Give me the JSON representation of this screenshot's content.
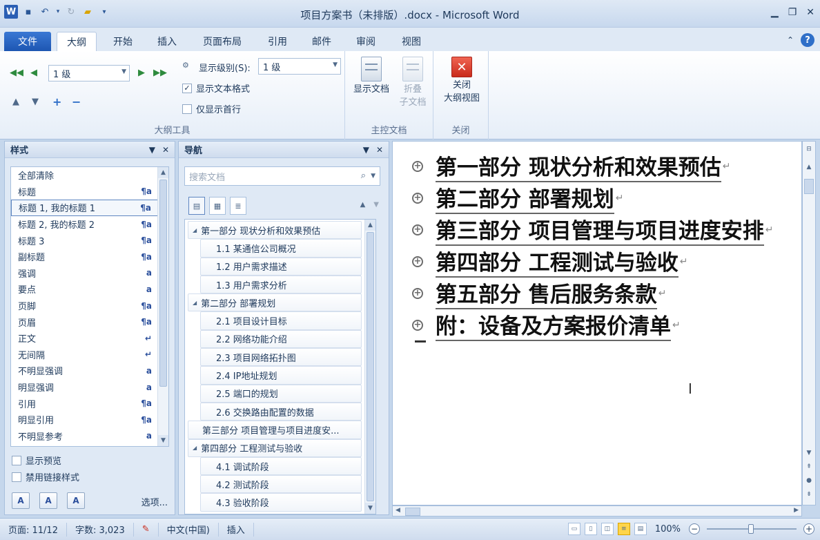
{
  "window": {
    "title": "项目方案书（未排版）.docx - Microsoft Word"
  },
  "tabs": [
    {
      "label": "文件"
    },
    {
      "label": "大纲"
    },
    {
      "label": "开始"
    },
    {
      "label": "插入"
    },
    {
      "label": "页面布局"
    },
    {
      "label": "引用"
    },
    {
      "label": "邮件"
    },
    {
      "label": "审阅"
    },
    {
      "label": "视图"
    }
  ],
  "ribbon": {
    "outline_tools": {
      "level_value": "1 级",
      "show_level_label": "显示级别(S):",
      "show_level_value": "1 级",
      "show_text_format": "显示文本格式",
      "show_first_line_only": "仅显示首行",
      "group_label": "大纲工具"
    },
    "master_doc": {
      "show_document": "显示文档",
      "collapse_line1": "折叠",
      "collapse_line2": "子文档",
      "group_label": "主控文档"
    },
    "close": {
      "line1": "关闭",
      "line2": "大纲视图",
      "group_label": "关闭"
    }
  },
  "styles_pane": {
    "title": "样式",
    "items": [
      {
        "label": "全部清除",
        "mark": ""
      },
      {
        "label": "标题",
        "mark": "¶a"
      },
      {
        "label": "标题 1, 我的标题 1",
        "mark": "¶a"
      },
      {
        "label": "标题 2, 我的标题 2",
        "mark": "¶a"
      },
      {
        "label": "标题 3",
        "mark": "¶a"
      },
      {
        "label": "副标题",
        "mark": "¶a"
      },
      {
        "label": "强调",
        "mark": "a"
      },
      {
        "label": "要点",
        "mark": "a"
      },
      {
        "label": "页脚",
        "mark": "¶a"
      },
      {
        "label": "页眉",
        "mark": "¶a"
      },
      {
        "label": "正文",
        "mark": "↵"
      },
      {
        "label": "无间隔",
        "mark": "↵"
      },
      {
        "label": "不明显强调",
        "mark": "a"
      },
      {
        "label": "明显强调",
        "mark": "a"
      },
      {
        "label": "引用",
        "mark": "¶a"
      },
      {
        "label": "明显引用",
        "mark": "¶a"
      },
      {
        "label": "不明显参考",
        "mark": "a"
      }
    ],
    "show_preview": "显示预览",
    "disable_linked": "禁用链接样式",
    "options_link": "选项..."
  },
  "nav_pane": {
    "title": "导航",
    "search_placeholder": "搜索文档",
    "nodes": [
      {
        "level": 1,
        "label": "第一部分  现状分析和效果预估"
      },
      {
        "level": 2,
        "label": "1.1 某通信公司概况"
      },
      {
        "level": 2,
        "label": "1.2 用户需求描述"
      },
      {
        "level": 2,
        "label": "1.3 用户需求分析"
      },
      {
        "level": 1,
        "label": "第二部分  部署规划"
      },
      {
        "level": 2,
        "label": "2.1 项目设计目标"
      },
      {
        "level": 2,
        "label": "2.2 网络功能介绍"
      },
      {
        "level": 2,
        "label": "2.3 项目网络拓扑图"
      },
      {
        "level": 2,
        "label": "2.4 IP地址规划"
      },
      {
        "level": 2,
        "label": "2.5 端口的规划"
      },
      {
        "level": 2,
        "label": "2.6 交换路由配置的数据"
      },
      {
        "level": 1,
        "label": "第三部分  项目管理与项目进度安..."
      },
      {
        "level": 1,
        "label": "第四部分  工程测试与验收"
      },
      {
        "level": 2,
        "label": "4.1 调试阶段"
      },
      {
        "level": 2,
        "label": "4.2 测试阶段"
      },
      {
        "level": 2,
        "label": "4.3 验收阶段"
      }
    ]
  },
  "document": {
    "headings": [
      {
        "text": "第一部分  现状分析和效果预估"
      },
      {
        "text": "第二部分  部署规划"
      },
      {
        "text": "第三部分  项目管理与项目进度安排"
      },
      {
        "text": "第四部分  工程测试与验收"
      },
      {
        "text": "第五部分  售后服务条款"
      },
      {
        "text": "附：设备及方案报价清单"
      }
    ]
  },
  "statusbar": {
    "page": "页面: 11/12",
    "words": "字数: 3,023",
    "language": "中文(中国)",
    "mode": "插入",
    "zoom": "100%"
  }
}
